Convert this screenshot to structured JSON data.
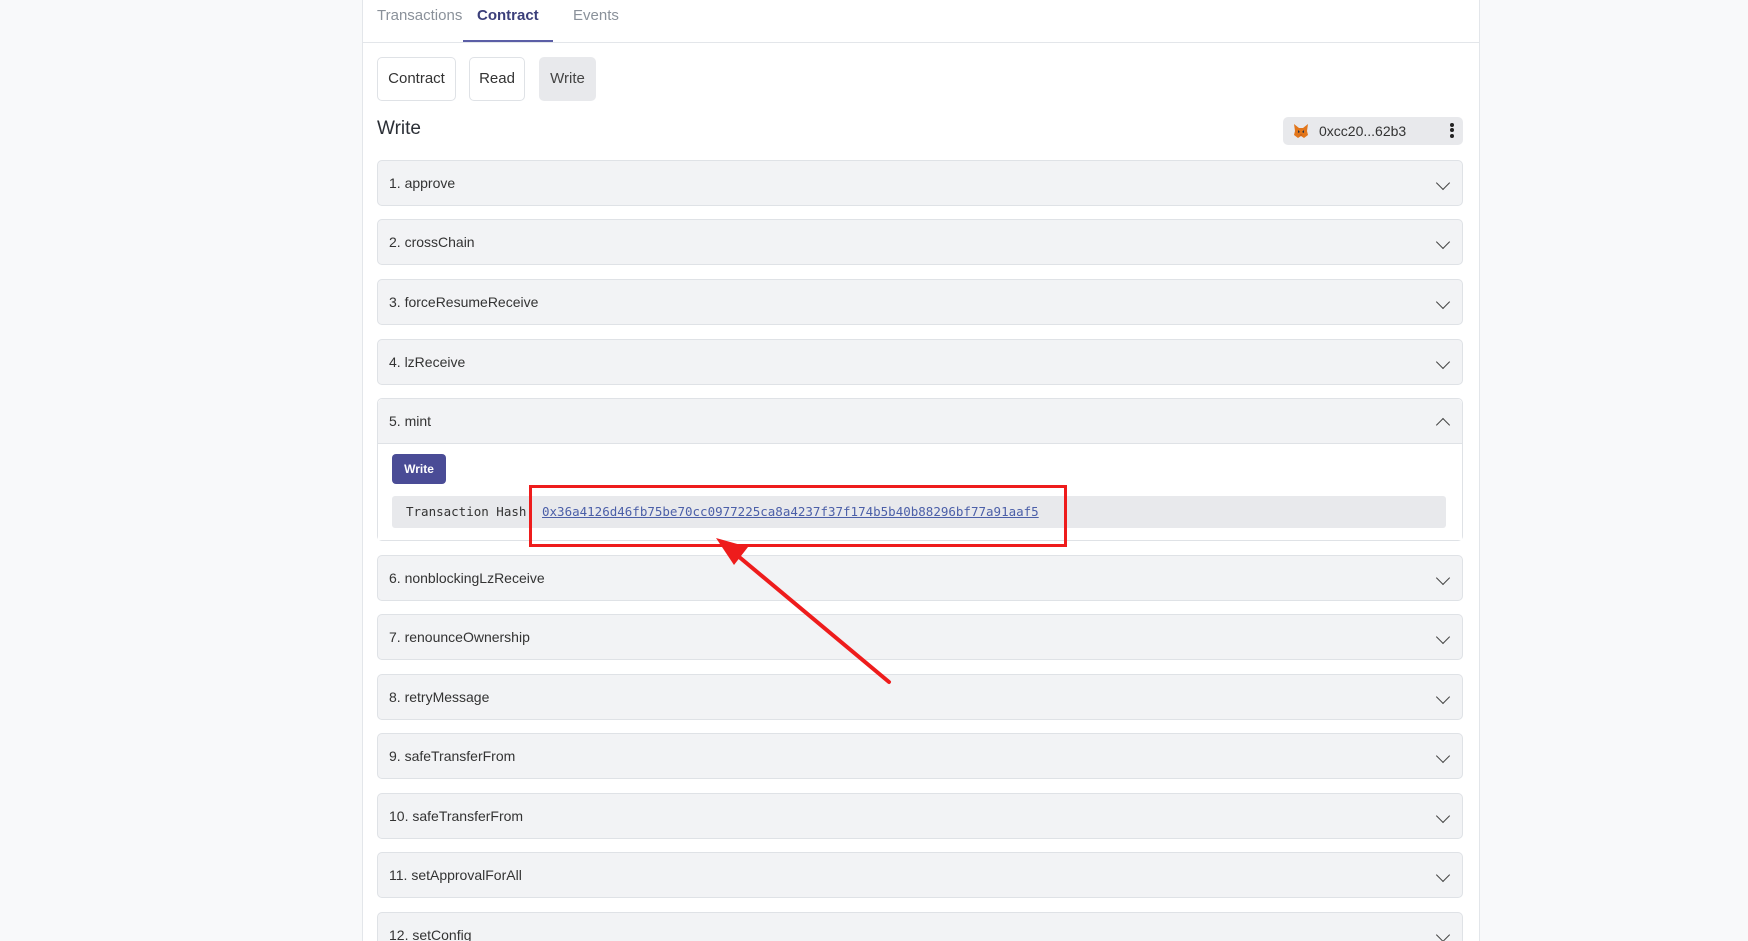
{
  "tabs": [
    {
      "label": "Transactions",
      "active": false
    },
    {
      "label": "Contract",
      "active": true
    },
    {
      "label": "Events",
      "active": false
    }
  ],
  "subtabs": [
    {
      "label": "Contract",
      "active": false
    },
    {
      "label": "Read",
      "active": false
    },
    {
      "label": "Write",
      "active": true
    }
  ],
  "section_title": "Write",
  "wallet": {
    "address": "0xcc20...62b3",
    "icon": "metamask-fox-icon"
  },
  "functions": [
    {
      "label": "1. approve",
      "expanded": false
    },
    {
      "label": "2. crossChain",
      "expanded": false
    },
    {
      "label": "3. forceResumeReceive",
      "expanded": false
    },
    {
      "label": "4. lzReceive",
      "expanded": false
    },
    {
      "label": "5. mint",
      "expanded": true
    },
    {
      "label": "6. nonblockingLzReceive",
      "expanded": false
    },
    {
      "label": "7. renounceOwnership",
      "expanded": false
    },
    {
      "label": "8. retryMessage",
      "expanded": false
    },
    {
      "label": "9. safeTransferFrom",
      "expanded": false
    },
    {
      "label": "10. safeTransferFrom",
      "expanded": false
    },
    {
      "label": "11. setApprovalForAll",
      "expanded": false
    },
    {
      "label": "12. setConfig",
      "expanded": false
    }
  ],
  "mint": {
    "write_label": "Write",
    "hash_label": "Transaction Hash",
    "hash_value": "0x36a4126d46fb75be70cc0977225ca8a4237f37f174b5b40b88296bf77a91aaf5"
  },
  "colors": {
    "accent": "#4a4c96",
    "annotation": "#ee1c1c",
    "link": "#4b5fa8"
  }
}
